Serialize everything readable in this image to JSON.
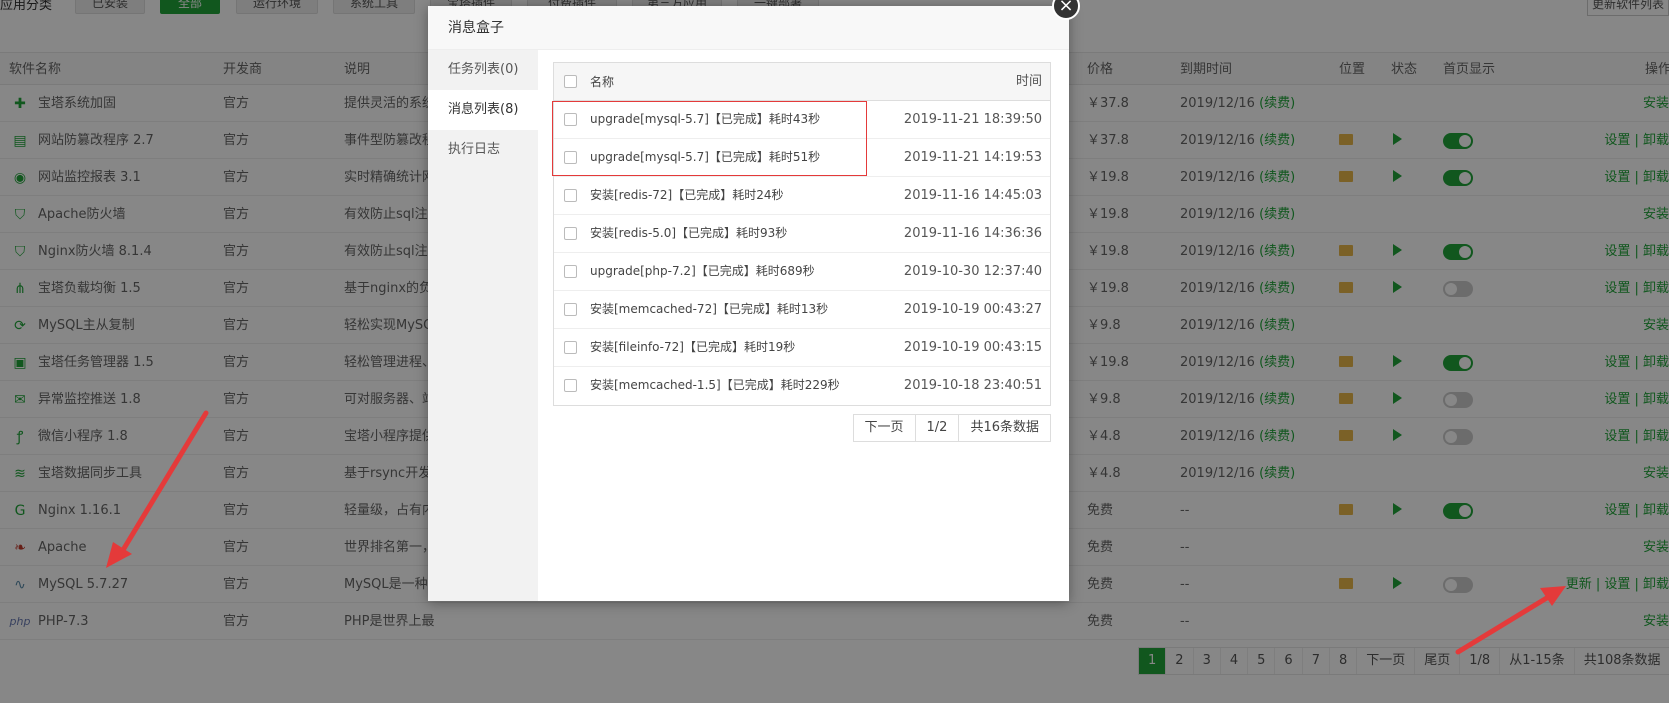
{
  "categories": {
    "label": "应用分类",
    "buttons": [
      "已安装",
      "全部",
      "运行环境",
      "系统工具",
      "宝塔插件",
      "付费插件",
      "第三方应用",
      "一键部署"
    ],
    "active_index": 1,
    "update_list": "更新软件列表"
  },
  "table": {
    "headers": [
      "软件名称",
      "开发商",
      "说明",
      "价格",
      "到期时间",
      "位置",
      "状态",
      "首页显示",
      "操作"
    ],
    "rows": [
      {
        "icon": "shield-plus-icon",
        "name": "宝塔系统加固",
        "vendor": "官方",
        "desc": "提供灵活的系统",
        "price": "￥37.8",
        "expire": "2019/12/16",
        "renew": "(续费)",
        "folder": false,
        "play": false,
        "toggle": "none",
        "ops": "安装"
      },
      {
        "icon": "web-tamper-icon",
        "name": "网站防篡改程序 2.7",
        "vendor": "官方",
        "desc": "事件型防篡改程",
        "price": "￥37.8",
        "expire": "2019/12/16",
        "renew": "(续费)",
        "folder": true,
        "play": true,
        "toggle": "on",
        "ops": "设置 | 卸载"
      },
      {
        "icon": "globe-monitor-icon",
        "name": "网站监控报表 3.1",
        "vendor": "官方",
        "desc": "实时精确统计网",
        "price": "￥19.8",
        "expire": "2019/12/16",
        "renew": "(续费)",
        "folder": true,
        "play": true,
        "toggle": "on",
        "ops": "设置 | 卸载"
      },
      {
        "icon": "waf-icon",
        "name": "Apache防火墙",
        "vendor": "官方",
        "desc": "有效防止sql注入",
        "price": "￥19.8",
        "expire": "2019/12/16",
        "renew": "(续费)",
        "folder": false,
        "play": false,
        "toggle": "none",
        "ops": "安装"
      },
      {
        "icon": "waf-icon",
        "name": "Nginx防火墙 8.1.4",
        "vendor": "官方",
        "desc": "有效防止sql注入",
        "price": "￥19.8",
        "expire": "2019/12/16",
        "renew": "(续费)",
        "folder": true,
        "play": true,
        "toggle": "on",
        "ops": "设置 | 卸载"
      },
      {
        "icon": "load-balance-icon",
        "name": "宝塔负载均衡 1.5",
        "vendor": "官方",
        "desc": "基于nginx的负载",
        "price": "￥19.8",
        "expire": "2019/12/16",
        "renew": "(续费)",
        "folder": true,
        "play": true,
        "toggle": "off",
        "ops": "设置 | 卸载"
      },
      {
        "icon": "mysql-replication-icon",
        "name": "MySQL主从复制",
        "vendor": "官方",
        "desc": "轻松实现MySQL",
        "price": "￥9.8",
        "expire": "2019/12/16",
        "renew": "(续费)",
        "folder": false,
        "play": false,
        "toggle": "none",
        "ops": "安装"
      },
      {
        "icon": "task-manager-icon",
        "name": "宝塔任务管理器 1.5",
        "vendor": "官方",
        "desc": "轻松管理进程、",
        "price": "￥19.8",
        "expire": "2019/12/16",
        "renew": "(续费)",
        "folder": true,
        "play": true,
        "toggle": "on",
        "ops": "设置 | 卸载"
      },
      {
        "icon": "alert-push-icon",
        "name": "异常监控推送 1.8",
        "vendor": "官方",
        "desc": "可对服务器、站",
        "price": "￥9.8",
        "expire": "2019/12/16",
        "renew": "(续费)",
        "folder": true,
        "play": true,
        "toggle": "off",
        "ops": "设置 | 卸载"
      },
      {
        "icon": "mini-program-icon",
        "name": "微信小程序 1.8",
        "vendor": "官方",
        "desc": "宝塔小程序提供",
        "price": "￥4.8",
        "expire": "2019/12/16",
        "renew": "(续费)",
        "folder": true,
        "play": true,
        "toggle": "off",
        "ops": "设置 | 卸载"
      },
      {
        "icon": "data-sync-icon",
        "name": "宝塔数据同步工具",
        "vendor": "官方",
        "desc": "基于rsync开发的",
        "price": "￥4.8",
        "expire": "2019/12/16",
        "renew": "(续费)",
        "folder": false,
        "play": false,
        "toggle": "none",
        "ops": "安装"
      },
      {
        "icon": "nginx-icon",
        "name": "Nginx 1.16.1",
        "vendor": "官方",
        "desc": "轻量级，占有内",
        "price": "免费",
        "expire": "--",
        "renew": "",
        "folder": true,
        "play": true,
        "toggle": "on",
        "ops": "设置 | 卸载"
      },
      {
        "icon": "apache-feather-icon",
        "name": "Apache",
        "vendor": "官方",
        "desc": "世界排名第一，",
        "price": "免费",
        "expire": "--",
        "renew": "",
        "folder": false,
        "play": false,
        "toggle": "none",
        "ops": "安装"
      },
      {
        "icon": "mysql-dolphin-icon",
        "name": "MySQL 5.7.27",
        "vendor": "官方",
        "desc": "MySQL是一种关",
        "price": "免费",
        "expire": "--",
        "renew": "",
        "folder": true,
        "play": true,
        "toggle": "off",
        "ops": "更新 | 设置 | 卸载"
      },
      {
        "icon": "php-icon",
        "name": "PHP-7.3",
        "vendor": "官方",
        "desc": "PHP是世界上最好的编程语言",
        "price": "免费",
        "expire": "--",
        "renew": "",
        "folder": false,
        "play": false,
        "toggle": "none",
        "ops": "安装"
      }
    ]
  },
  "pager": {
    "pages": [
      "1",
      "2",
      "3",
      "4",
      "5",
      "6",
      "7",
      "8"
    ],
    "current": "1",
    "next": "下一页",
    "last": "尾页",
    "page_info": "1/8",
    "range": "从1-15条",
    "total": "共108条数据"
  },
  "modal": {
    "title": "消息盒子",
    "tabs": [
      "任务列表(0)",
      "消息列表(8)",
      "执行日志"
    ],
    "active_tab": 1,
    "col_name": "名称",
    "col_time": "时间",
    "messages": [
      {
        "name": "upgrade[mysql-5.7]【已完成】耗时43秒",
        "time": "2019-11-21 18:39:50"
      },
      {
        "name": "upgrade[mysql-5.7]【已完成】耗时51秒",
        "time": "2019-11-21 14:19:53"
      },
      {
        "name": "安装[redis-72]【已完成】耗时24秒",
        "time": "2019-11-16 14:45:03"
      },
      {
        "name": "安装[redis-5.0]【已完成】耗时93秒",
        "time": "2019-11-16 14:36:36"
      },
      {
        "name": "upgrade[php-7.2]【已完成】耗时689秒",
        "time": "2019-10-30 12:37:40"
      },
      {
        "name": "安装[memcached-72]【已完成】耗时13秒",
        "time": "2019-10-19 00:43:27"
      },
      {
        "name": "安装[fileinfo-72]【已完成】耗时19秒",
        "time": "2019-10-19 00:43:15"
      },
      {
        "name": "安装[memcached-1.5]【已完成】耗时229秒",
        "time": "2019-10-18 23:40:51"
      }
    ],
    "pager": {
      "next": "下一页",
      "page_info": "1/2",
      "total": "共16条数据"
    },
    "close_icon": "close-icon"
  },
  "colors": {
    "accent": "#20a53a",
    "price": "#f0692c",
    "highlight": "#e43a3a"
  }
}
